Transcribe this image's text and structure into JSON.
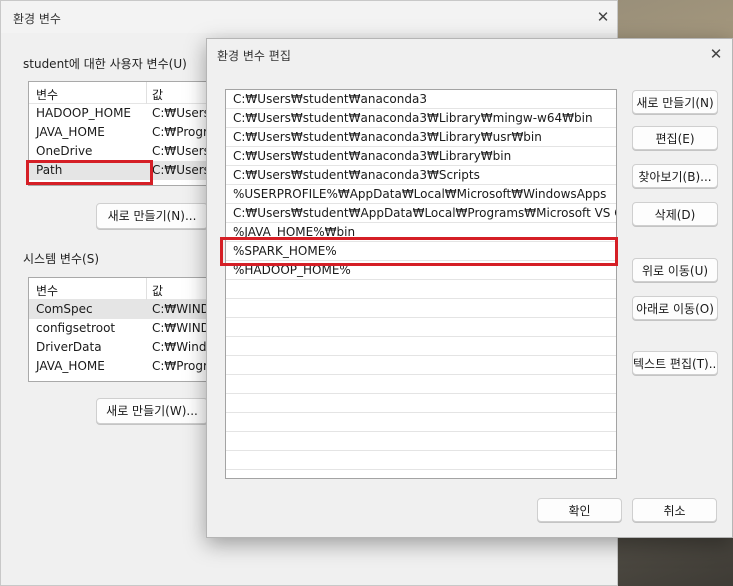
{
  "background_window": {
    "title": "환경 변수",
    "user_group_label": "student에 대한 사용자 변수(U)",
    "user_columns": [
      "변수",
      "값"
    ],
    "user_vars": [
      {
        "name": "HADOOP_HOME",
        "value": "C:₩Users₩"
      },
      {
        "name": "JAVA_HOME",
        "value": "C:₩Progra"
      },
      {
        "name": "OneDrive",
        "value": "C:₩Users₩"
      },
      {
        "name": "Path",
        "value": "C:₩Users₩"
      }
    ],
    "user_new_button": "새로 만들기(N)...",
    "system_group_label": "시스템 변수(S)",
    "system_columns": [
      "변수",
      "값"
    ],
    "system_vars": [
      {
        "name": "ComSpec",
        "value": "C:₩WINDO"
      },
      {
        "name": "configsetroot",
        "value": "C:₩WINDO"
      },
      {
        "name": "DriverData",
        "value": "C:₩Windo"
      },
      {
        "name": "JAVA_HOME",
        "value": "C:₩Progra"
      }
    ],
    "system_new_button": "새로 만들기(W)..."
  },
  "dialog": {
    "title": "환경 변수 편집",
    "paths": [
      "C:₩Users₩student₩anaconda3",
      "C:₩Users₩student₩anaconda3₩Library₩mingw-w64₩bin",
      "C:₩Users₩student₩anaconda3₩Library₩usr₩bin",
      "C:₩Users₩student₩anaconda3₩Library₩bin",
      "C:₩Users₩student₩anaconda3₩Scripts",
      "%USERPROFILE%₩AppData₩Local₩Microsoft₩WindowsApps",
      "C:₩Users₩student₩AppData₩Local₩Programs₩Microsoft VS Code₩...",
      "%JAVA_HOME%₩bin",
      "%SPARK_HOME%",
      "%HADOOP_HOME%"
    ],
    "buttons": {
      "new": "새로 만들기(N)",
      "edit": "편집(E)",
      "browse": "찾아보기(B)...",
      "delete": "삭제(D)",
      "move_up": "위로 이동(U)",
      "move_down": "아래로 이동(O)",
      "edit_text": "텍스트 편집(T)...",
      "ok": "확인",
      "cancel": "취소"
    }
  },
  "colors": {
    "highlight": "#d51f26"
  }
}
